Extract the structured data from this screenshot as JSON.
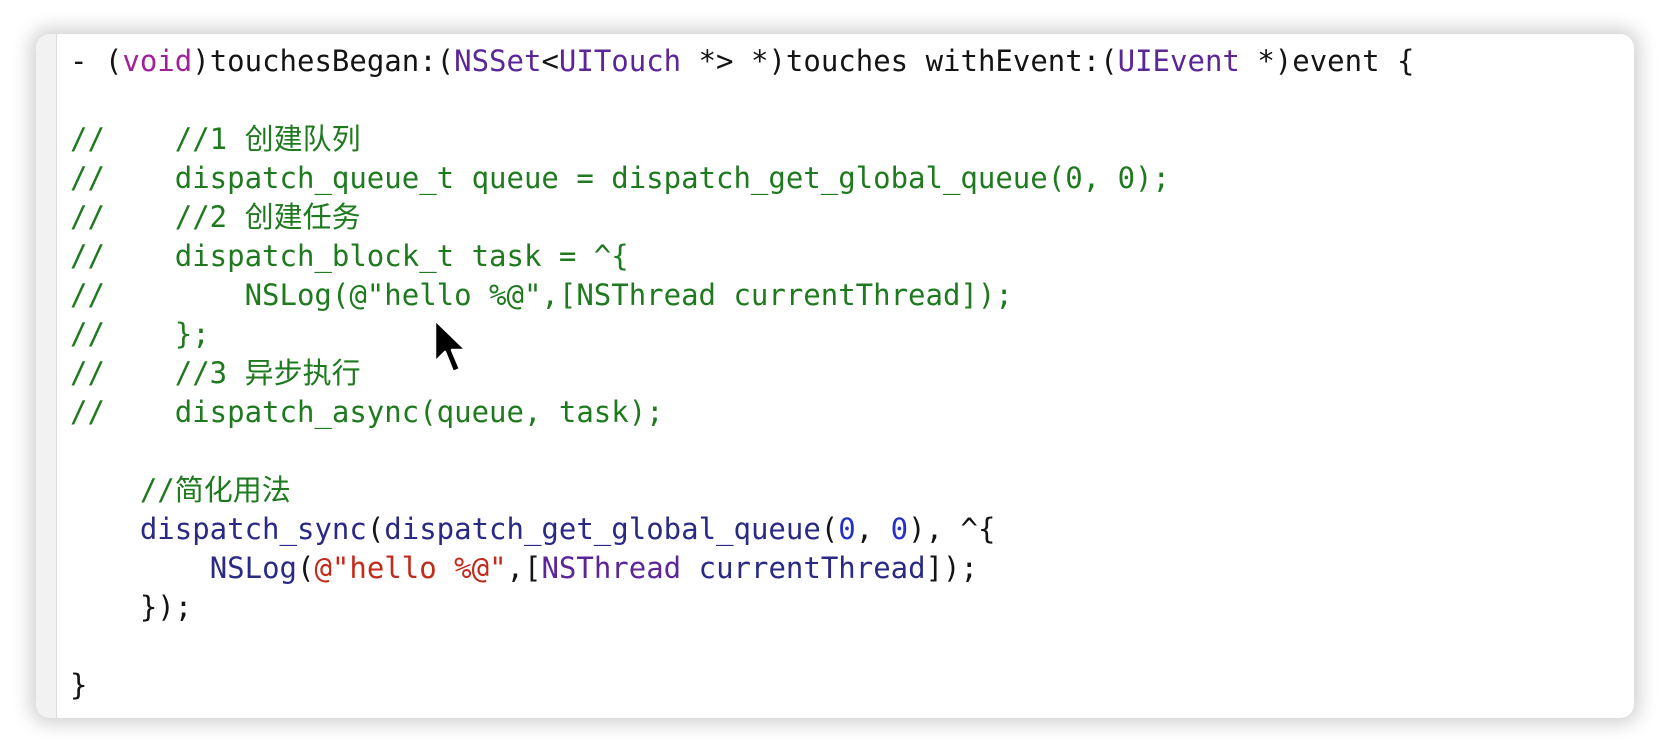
{
  "editor": {
    "lines": [
      {
        "tokens": [
          {
            "t": "- (",
            "k": "plain"
          },
          {
            "t": "void",
            "k": "keyword"
          },
          {
            "t": ")touchesBegan:(",
            "k": "plain"
          },
          {
            "t": "NSSet",
            "k": "class"
          },
          {
            "t": "<",
            "k": "plain"
          },
          {
            "t": "UITouch",
            "k": "class"
          },
          {
            "t": " *> *)touches withEvent:(",
            "k": "plain"
          },
          {
            "t": "UIEvent",
            "k": "class"
          },
          {
            "t": " *)event {",
            "k": "plain"
          }
        ]
      },
      {
        "tokens": [
          {
            "t": "",
            "k": "plain"
          }
        ]
      },
      {
        "tokens": [
          {
            "t": "//    //1 创建队列",
            "k": "comment"
          }
        ]
      },
      {
        "tokens": [
          {
            "t": "//    dispatch_queue_t queue = dispatch_get_global_queue(0, 0);",
            "k": "comment"
          }
        ]
      },
      {
        "tokens": [
          {
            "t": "//    //2 创建任务",
            "k": "comment"
          }
        ]
      },
      {
        "tokens": [
          {
            "t": "//    dispatch_block_t task = ^{",
            "k": "comment"
          }
        ]
      },
      {
        "tokens": [
          {
            "t": "//        NSLog(@\"hello %@\",[NSThread currentThread]);",
            "k": "comment"
          }
        ]
      },
      {
        "tokens": [
          {
            "t": "//    };",
            "k": "comment"
          }
        ]
      },
      {
        "tokens": [
          {
            "t": "//    //3 异步执行",
            "k": "comment"
          }
        ]
      },
      {
        "tokens": [
          {
            "t": "//    dispatch_async(queue, task);",
            "k": "comment"
          }
        ]
      },
      {
        "tokens": [
          {
            "t": "",
            "k": "plain"
          }
        ]
      },
      {
        "tokens": [
          {
            "t": "    //简化用法",
            "k": "comment"
          }
        ]
      },
      {
        "tokens": [
          {
            "t": "    ",
            "k": "plain"
          },
          {
            "t": "dispatch_sync",
            "k": "func"
          },
          {
            "t": "(",
            "k": "plain"
          },
          {
            "t": "dispatch_get_global_queue",
            "k": "func"
          },
          {
            "t": "(",
            "k": "plain"
          },
          {
            "t": "0",
            "k": "number"
          },
          {
            "t": ", ",
            "k": "plain"
          },
          {
            "t": "0",
            "k": "number"
          },
          {
            "t": "), ^{",
            "k": "plain"
          }
        ]
      },
      {
        "tokens": [
          {
            "t": "        ",
            "k": "plain"
          },
          {
            "t": "NSLog",
            "k": "func"
          },
          {
            "t": "(",
            "k": "plain"
          },
          {
            "t": "@\"hello %@\"",
            "k": "string"
          },
          {
            "t": ",[",
            "k": "plain"
          },
          {
            "t": "NSThread",
            "k": "class"
          },
          {
            "t": " ",
            "k": "plain"
          },
          {
            "t": "currentThread",
            "k": "func"
          },
          {
            "t": "]);",
            "k": "plain"
          }
        ]
      },
      {
        "tokens": [
          {
            "t": "    });",
            "k": "plain"
          }
        ]
      },
      {
        "tokens": [
          {
            "t": "",
            "k": "plain"
          }
        ]
      },
      {
        "tokens": [
          {
            "t": "}",
            "k": "plain"
          }
        ]
      }
    ]
  },
  "colors": {
    "comment": "#1f7a1f",
    "keyword": "#a0229a",
    "class": "#5c2699",
    "func": "#2a2a85",
    "string": "#c42a1c",
    "number": "#2431c8"
  },
  "icons": {
    "cursor": "mouse-pointer-icon"
  }
}
